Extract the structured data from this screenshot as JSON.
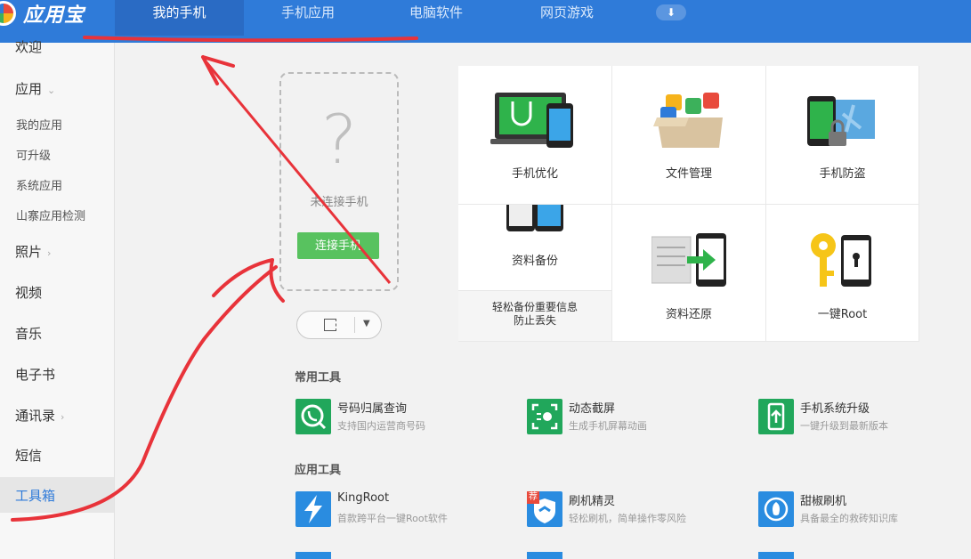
{
  "app": {
    "title": "应用宝"
  },
  "tabs": [
    {
      "label": "我的手机",
      "active": true
    },
    {
      "label": "手机应用",
      "active": false
    },
    {
      "label": "电脑软件",
      "active": false
    },
    {
      "label": "网页游戏",
      "active": false
    }
  ],
  "sidebar": {
    "welcome": "欢迎",
    "apps": "应用",
    "my_apps": "我的应用",
    "upgradable": "可升级",
    "system_apps": "系统应用",
    "fake_check": "山寨应用检测",
    "photos": "照片",
    "videos": "视频",
    "music": "音乐",
    "ebooks": "电子书",
    "contacts": "通讯录",
    "sms": "短信",
    "toolbox": "工具箱"
  },
  "phone_card": {
    "status": "未连接手机",
    "connect_label": "连接手机"
  },
  "features": {
    "optimize": "手机优化",
    "files": "文件管理",
    "antitheft": "手机防盗",
    "backup": "资料备份",
    "backup_note_1": "轻松备份重要信息",
    "backup_note_2": "防止丢失",
    "restore": "资料还原",
    "root": "一键Root"
  },
  "common_tools": {
    "title": "常用工具",
    "items": [
      {
        "name": "号码归属查询",
        "desc": "支持国内运营商号码",
        "icon": "phone-search-icon"
      },
      {
        "name": "动态截屏",
        "desc": "生成手机屏幕动画",
        "icon": "screen-record-icon"
      },
      {
        "name": "手机系统升级",
        "desc": "一键升级到最新版本",
        "icon": "system-upgrade-icon"
      }
    ]
  },
  "app_tools": {
    "title": "应用工具",
    "items": [
      {
        "name": "KingRoot",
        "desc": "首款跨平台一键Root软件",
        "icon": "kingroot-icon"
      },
      {
        "name": "刷机精灵",
        "desc": "轻松刷机，简单操作零风险",
        "icon": "flash-icon",
        "badge": "荐"
      },
      {
        "name": "甜椒刷机",
        "desc": "具备最全的救砖知识库",
        "icon": "pepper-icon"
      }
    ]
  },
  "colors": {
    "topbar": "#2f7bd9",
    "accent_green": "#58c25f",
    "tool_green": "#21a75b",
    "tool_blue": "#2a8ce0",
    "annotation_red": "#e8333a"
  }
}
